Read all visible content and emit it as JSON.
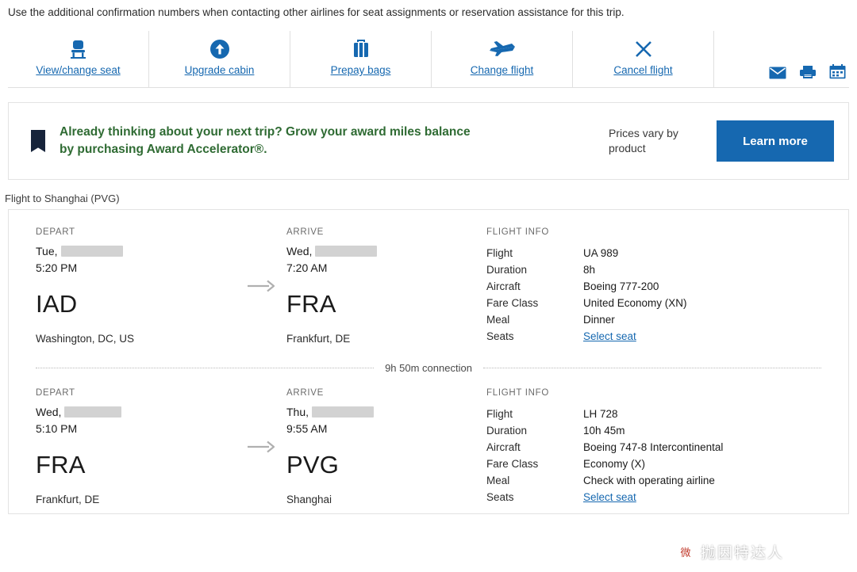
{
  "top_note": "Use the additional confirmation numbers when contacting other airlines for seat assignments or reservation assistance for this trip.",
  "actions": [
    {
      "label": "View/change seat",
      "icon": "seat-icon"
    },
    {
      "label": "Upgrade cabin",
      "icon": "arrow-up-circle-icon"
    },
    {
      "label": "Prepay bags",
      "icon": "suitcase-icon"
    },
    {
      "label": "Change flight",
      "icon": "airplane-icon"
    },
    {
      "label": "Cancel flight",
      "icon": "x-icon"
    }
  ],
  "utility_icons": [
    {
      "name": "email-icon"
    },
    {
      "name": "printer-icon"
    },
    {
      "name": "calendar-icon"
    }
  ],
  "promo": {
    "headline": "Already thinking about your next trip? Grow your award miles balance by purchasing Award Accelerator®.",
    "note": "Prices vary by product",
    "button_label": "Learn more",
    "accent_color": "#1668b0",
    "headline_color": "#2f6b33"
  },
  "flight_heading": "Flight to Shanghai (PVG)",
  "connection": "9h 50m connection",
  "labels": {
    "depart": "DEPART",
    "arrive": "ARRIVE",
    "flight_info": "FLIGHT INFO",
    "flight": "Flight",
    "duration": "Duration",
    "aircraft": "Aircraft",
    "fare_class": "Fare Class",
    "meal": "Meal",
    "seats": "Seats",
    "select_seat": "Select seat"
  },
  "segments": [
    {
      "depart": {
        "day": "Tue,",
        "date_redacted": true,
        "time": "5:20 PM",
        "code": "IAD",
        "city": "Washington, DC, US"
      },
      "arrive": {
        "day": "Wed,",
        "date_redacted": true,
        "time": "7:20 AM",
        "code": "FRA",
        "city": "Frankfurt, DE"
      },
      "info": {
        "flight": "UA 989",
        "duration": "8h",
        "aircraft": "Boeing 777-200",
        "fare_class": "United Economy (XN)",
        "meal": "Dinner",
        "seats_link": "Select seat"
      }
    },
    {
      "depart": {
        "day": "Wed,",
        "date_redacted": true,
        "time": "5:10 PM",
        "code": "FRA",
        "city": "Frankfurt, DE"
      },
      "arrive": {
        "day": "Thu,",
        "date_redacted": true,
        "time": "9:55 AM",
        "code": "PVG",
        "city": "Shanghai"
      },
      "info": {
        "flight": "LH 728",
        "duration": "10h 45m",
        "aircraft": "Boeing 747-8 Intercontinental",
        "fare_class": "Economy (X)",
        "meal": "Check with operating airline",
        "seats_link": "Select seat"
      }
    }
  ],
  "watermark": {
    "text": "抛因特达人",
    "badge": "微"
  }
}
